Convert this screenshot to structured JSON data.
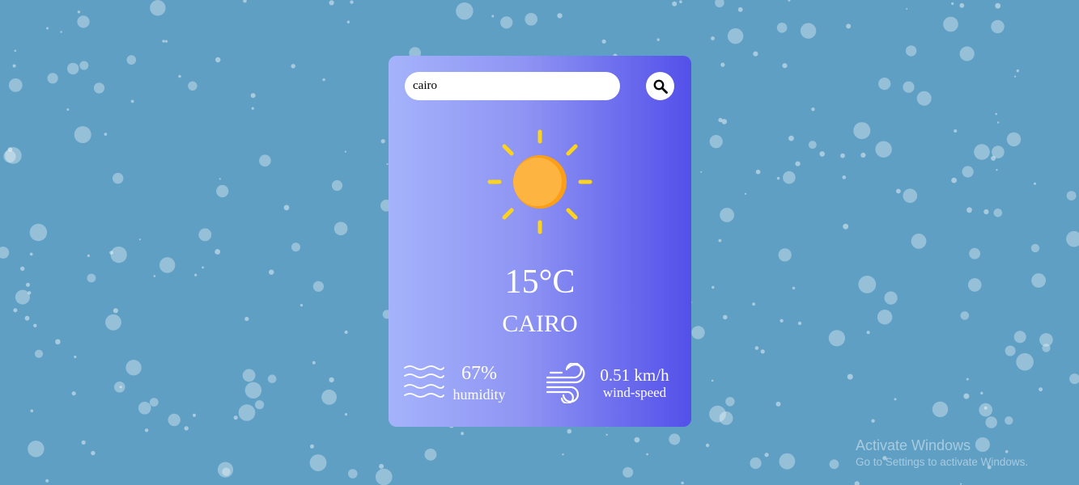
{
  "background": {
    "color": "#5f9fc4",
    "decoration": "snow-bubbles"
  },
  "search": {
    "value": "cairo",
    "button_icon": "search-icon"
  },
  "weather": {
    "icon": "sun-icon",
    "temperature": "15°C",
    "city": "CAIRO",
    "humidity": {
      "value": "67%",
      "label": "humidity",
      "icon": "waves-icon"
    },
    "wind": {
      "value": "0.51 km/h",
      "label": "wind-speed",
      "icon": "wind-icon"
    }
  },
  "colors": {
    "card_gradient_start": "#a5b3fb",
    "card_gradient_end": "#5350ea",
    "sun_body": "#fdb440",
    "sun_shade": "#fd9f16",
    "sun_rays": "#fdd41a"
  },
  "os_watermark": {
    "title": "Activate Windows",
    "subtitle": "Go to Settings to activate Windows."
  }
}
